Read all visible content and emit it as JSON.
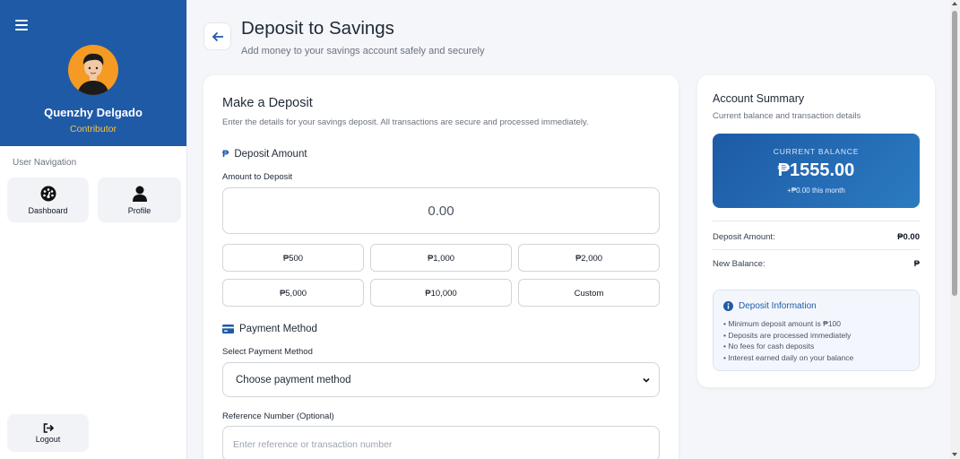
{
  "sidebar": {
    "user": {
      "name": "Quenzhy Delgado",
      "role": "Contributor"
    },
    "nav_title": "User Navigation",
    "nav": [
      {
        "label": "Dashboard",
        "icon": "dashboard-gauge-icon"
      },
      {
        "label": "Profile",
        "icon": "user-icon"
      }
    ],
    "logout_label": "Logout"
  },
  "header": {
    "title": "Deposit to Savings",
    "subtitle": "Add money to your savings account safely and securely"
  },
  "deposit": {
    "title": "Make a Deposit",
    "subtitle": "Enter the details for your savings deposit. All transactions are secure and processed immediately.",
    "amount_section": "Deposit Amount",
    "amount_label": "Amount to Deposit",
    "amount_value": "0.00",
    "quick_amounts": [
      "₱500",
      "₱1,000",
      "₱2,000",
      "₱5,000",
      "₱10,000",
      "Custom"
    ],
    "payment_section": "Payment Method",
    "payment_label": "Select Payment Method",
    "payment_selected": "Choose payment method",
    "reference_label": "Reference Number (Optional)",
    "reference_placeholder": "Enter reference or transaction number"
  },
  "summary": {
    "title": "Account Summary",
    "subtitle": "Current balance and transaction details",
    "balance_label": "CURRENT BALANCE",
    "balance_value": "₱1555.00",
    "balance_month": "+₱0.00 this month",
    "deposit_amount_label": "Deposit Amount:",
    "deposit_amount_value": "₱0.00",
    "new_balance_label": "New Balance:",
    "new_balance_value": "₱",
    "info_title": "Deposit Information",
    "info_items": [
      "• Minimum deposit amount is ₱100",
      "• Deposits are processed immediately",
      "• No fees for cash deposits",
      "• Interest earned daily on your balance"
    ]
  },
  "colors": {
    "brand": "#1f5aa6",
    "accent": "#f6c343",
    "avatar_bg": "#f59a23"
  }
}
